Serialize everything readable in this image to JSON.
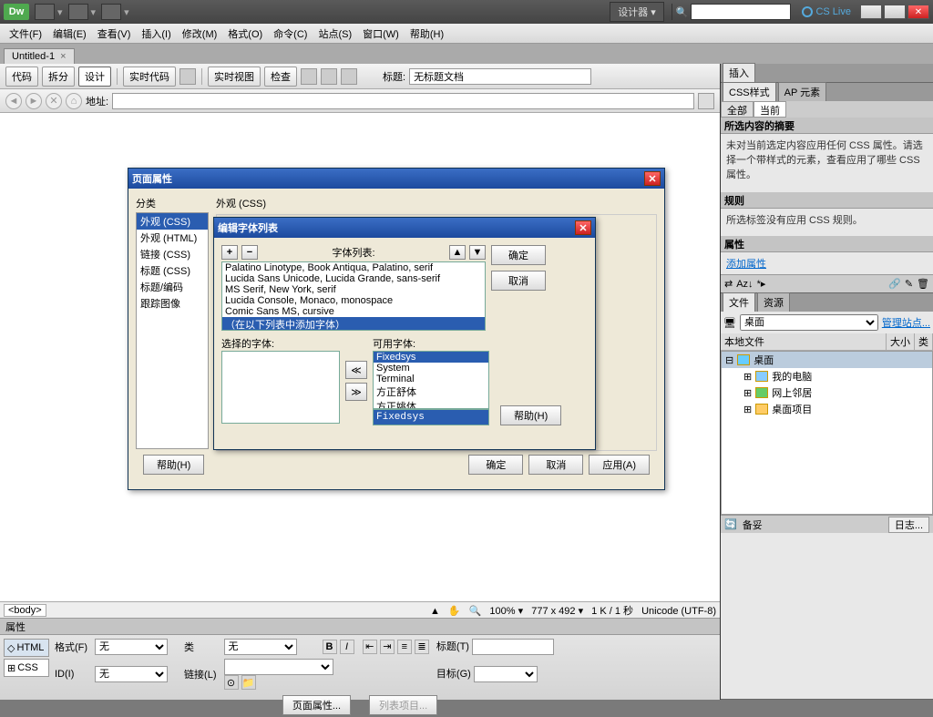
{
  "appbar": {
    "logo": "Dw",
    "designer": "设计器",
    "cslive": "CS Live"
  },
  "menubar": {
    "items": [
      "文件(F)",
      "编辑(E)",
      "查看(V)",
      "插入(I)",
      "修改(M)",
      "格式(O)",
      "命令(C)",
      "站点(S)",
      "窗口(W)",
      "帮助(H)"
    ]
  },
  "doctab": {
    "title": "Untitled-1",
    "close": "×"
  },
  "toolbar": {
    "code": "代码",
    "split": "拆分",
    "design": "设计",
    "livecode": "实时代码",
    "liveview": "实时视图",
    "inspect": "检查",
    "title_label": "标题:",
    "title_value": "无标题文档"
  },
  "addr": {
    "label": "地址:"
  },
  "tagselector": {
    "tag": "<body>",
    "zoom": "100%",
    "dims": "777 x 492",
    "size": "1 K / 1 秒",
    "encoding": "Unicode (UTF-8)"
  },
  "props": {
    "header": "属性",
    "mode_html": "HTML",
    "mode_css": "CSS",
    "format_label": "格式(F)",
    "format_value": "无",
    "id_label": "ID(I)",
    "id_value": "无",
    "class_label": "类",
    "class_value": "无",
    "link_label": "链接(L)",
    "title_label": "标题(T)",
    "target_label": "目标(G)",
    "pageprops_btn": "页面属性...",
    "listitem_btn": "列表项目..."
  },
  "rightpanels": {
    "insert_tab": "插入",
    "css_tab": "CSS样式",
    "ap_tab": "AP 元素",
    "all": "全部",
    "current": "当前",
    "summary_hdr": "所选内容的摘要",
    "summary_text": "未对当前选定内容应用任何 CSS 属性。请选择一个带样式的元素，查看应用了哪些 CSS 属性。",
    "rules_hdr": "规则",
    "rules_text": "所选标签没有应用 CSS 规则。",
    "attrs_hdr": "属性",
    "add_attr": "添加属性",
    "files_tab": "文件",
    "res_tab": "资源",
    "site_select": "桌面",
    "manage": "管理站点...",
    "localfiles": "本地文件",
    "size": "大小",
    "type": "类",
    "tree": [
      "桌面",
      "我的电脑",
      "网上邻居",
      "桌面项目"
    ],
    "ready": "备妥",
    "log": "日志..."
  },
  "pageprops_dialog": {
    "title": "页面属性",
    "cat_label": "分类",
    "appearance_label": "外观 (CSS)",
    "categories": [
      "外观 (CSS)",
      "外观 (HTML)",
      "链接 (CSS)",
      "标题 (CSS)",
      "标题/编码",
      "跟踪图像"
    ],
    "help": "帮助(H)",
    "ok": "确定",
    "cancel": "取消",
    "apply": "应用(A)"
  },
  "fontedit_dialog": {
    "title": "编辑字体列表",
    "fontlist_label": "字体列表:",
    "fonts": [
      "Palatino Linotype, Book Antiqua, Palatino, serif",
      "Lucida Sans Unicode, Lucida Grande, sans-serif",
      "MS Serif, New York, serif",
      "Lucida Console, Monaco, monospace",
      "Comic Sans MS, cursive",
      "（在以下列表中添加字体）"
    ],
    "selected_label": "选择的字体:",
    "available_label": "可用字体:",
    "available": [
      "Fixedsys",
      "System",
      "Terminal",
      "方正舒体",
      "方正姚体"
    ],
    "selected_font": "Fixedsys",
    "ok": "确定",
    "cancel": "取消",
    "help": "帮助(H)"
  }
}
